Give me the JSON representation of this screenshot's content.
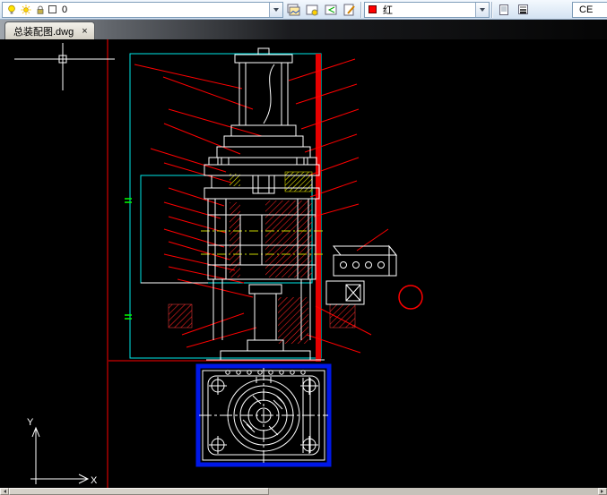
{
  "toolbar": {
    "layer_combo": {
      "value": "0",
      "swatch_color": "#ffffff"
    },
    "color_combo": {
      "value": "红",
      "swatch_color": "#ff0000"
    },
    "linetype_combo": {
      "value": "CE"
    },
    "dropdown_glyph": "▼"
  },
  "tabbar": {
    "tab_label": "总装配图.dwg",
    "close_glyph": "×"
  },
  "ucs": {
    "x_label": "X",
    "y_label": "Y"
  },
  "drawing": {
    "background": "#000000",
    "line_colors": {
      "white": "#ffffff",
      "red": "#ff0000",
      "cyan": "#00e8e8",
      "yellow": "#ffff00",
      "green": "#00ff00",
      "blue_border": "#0018e8",
      "centerline": "#c8d400"
    }
  }
}
